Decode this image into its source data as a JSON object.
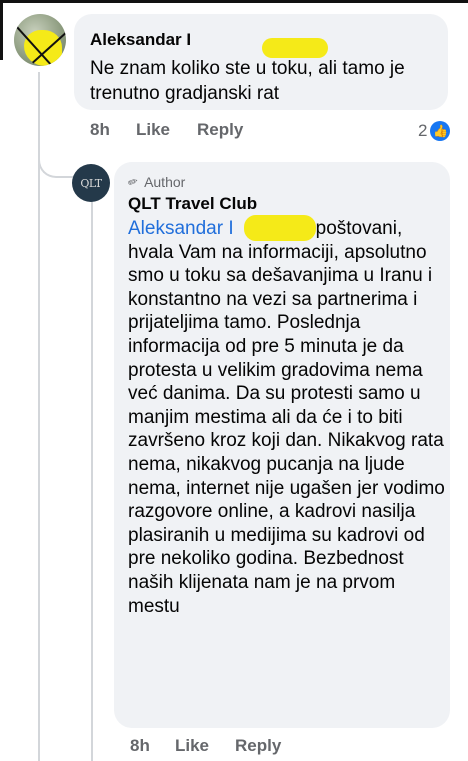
{
  "comment": {
    "author_name": "Aleksandar I",
    "text": "Ne znam koliko ste u toku, ali tamo je trenutno gradjanski rat",
    "time": "8h",
    "like_label": "Like",
    "reply_label": "Reply",
    "reaction_count": "2"
  },
  "reply": {
    "avatar_text": "QLT",
    "badge": "Author",
    "author_name": "QLT Travel Club",
    "mention": "Aleksandar I",
    "text": "poštovani, hvala Vam na informaciji, apsolutno smo u toku sa dešavanjima u Iranu i konstantno na vezi sa partnerima i prijateljima tamo. Poslednja informacija od pre 5 minuta je da protesta u velikim gradovima nema već danima. Da su protesti samo u manjim mestima ali da će i to biti završeno kroz koji dan. Nikakvog rata nema, nikakvog pucanja na ljude nema, internet nije ugašen jer vodimo razgovore online, a kadrovi nasilja plasiranih u medijima su kadrovi od pre nekoliko godina. Bezbednost naših klijenata nam je na prvom mestu",
    "time": "8h",
    "like_label": "Like",
    "reply_label": "Reply"
  },
  "colors": {
    "link": "#216fdb",
    "bubble": "#f0f2f5",
    "highlight": "#f5ea18",
    "meta": "#65676b"
  }
}
